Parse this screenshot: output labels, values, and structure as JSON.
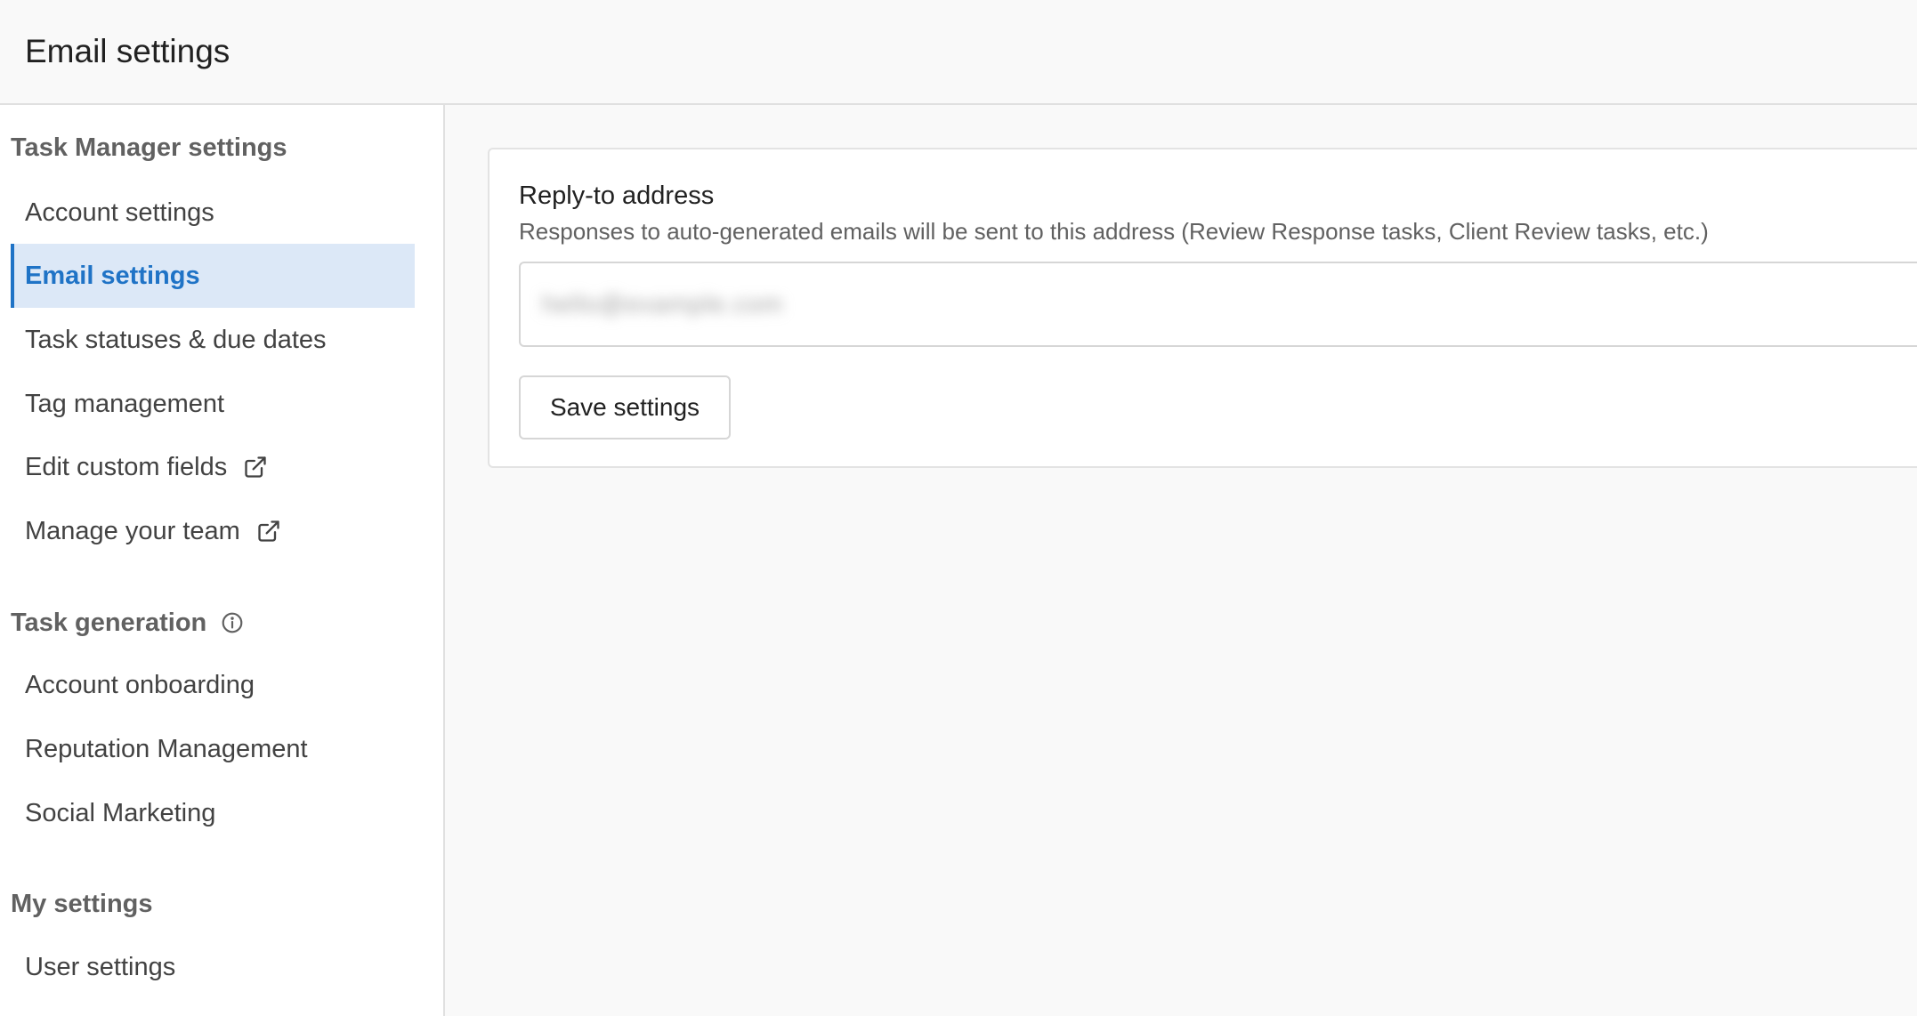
{
  "header": {
    "title": "Email settings"
  },
  "sidebar": {
    "sections": [
      {
        "title": "Task Manager settings",
        "items": [
          {
            "label": "Account settings"
          },
          {
            "label": "Email settings",
            "active": true
          },
          {
            "label": "Task statuses & due dates"
          },
          {
            "label": "Tag management"
          },
          {
            "label": "Edit custom fields",
            "icon": "external-link-icon"
          },
          {
            "label": "Manage your team",
            "icon": "external-link-icon"
          }
        ]
      },
      {
        "title": "Task generation",
        "title_icon": "info-icon",
        "items": [
          {
            "label": "Account onboarding"
          },
          {
            "label": "Reputation Management"
          },
          {
            "label": "Social Marketing"
          }
        ]
      },
      {
        "title": "My settings",
        "items": [
          {
            "label": "User settings"
          }
        ]
      }
    ]
  },
  "main": {
    "reply_to": {
      "label": "Reply-to address",
      "help": "Responses to auto-generated emails will be sent to this address (Review Response tasks, Client Review tasks, etc.)",
      "value": "hello@example.com"
    },
    "save_label": "Save settings"
  },
  "colors": {
    "accent": "#1f73c6",
    "active_bg": "#dce8f7",
    "page_bg": "#f9f9f9",
    "border": "#e0e0e0"
  }
}
